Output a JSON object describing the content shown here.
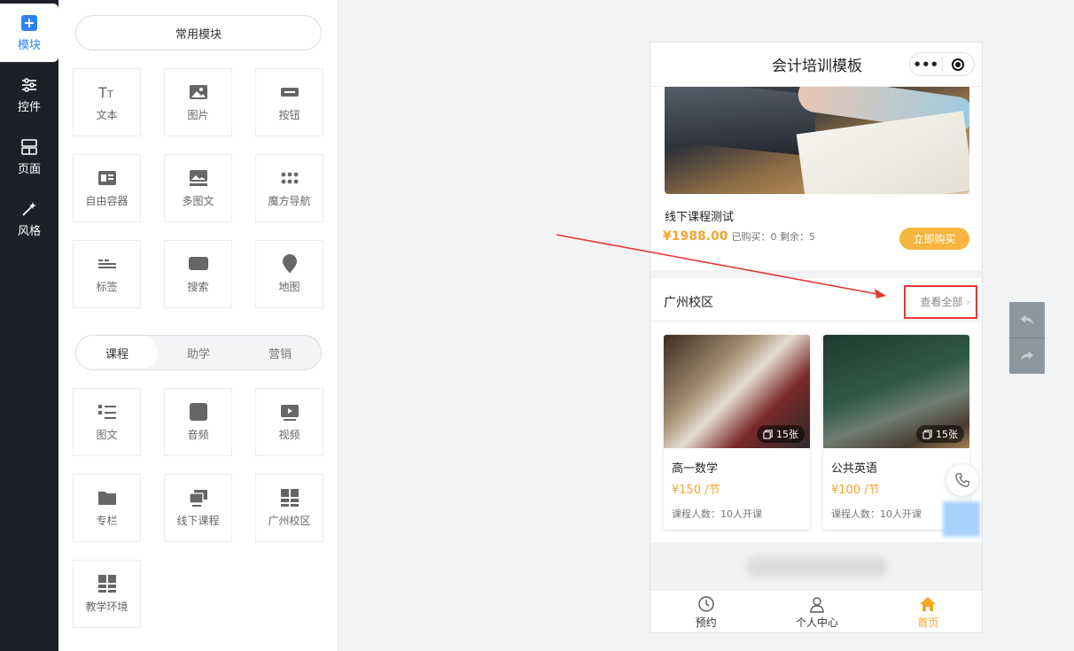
{
  "rail": {
    "items": [
      {
        "label": "模块",
        "icon": "plus-square-icon"
      },
      {
        "label": "控件",
        "icon": "sliders-icon"
      },
      {
        "label": "页面",
        "icon": "layout-icon"
      },
      {
        "label": "风格",
        "icon": "magic-wand-icon"
      }
    ]
  },
  "panel": {
    "common_label": "常用模块",
    "common_modules": [
      {
        "label": "文本",
        "icon": "text-icon"
      },
      {
        "label": "图片",
        "icon": "image-icon"
      },
      {
        "label": "按钮",
        "icon": "button-icon"
      },
      {
        "label": "自由容器",
        "icon": "container-icon"
      },
      {
        "label": "多图文",
        "icon": "multi-image-icon"
      },
      {
        "label": "魔方导航",
        "icon": "dots-grid-icon"
      },
      {
        "label": "标签",
        "icon": "tag-icon"
      },
      {
        "label": "搜索",
        "icon": "search-icon"
      },
      {
        "label": "地图",
        "icon": "map-pin-icon"
      }
    ],
    "tabs": [
      "课程",
      "助学",
      "营销"
    ],
    "course_modules": [
      {
        "label": "图文",
        "icon": "list-icon"
      },
      {
        "label": "音频",
        "icon": "music-icon"
      },
      {
        "label": "视频",
        "icon": "video-icon"
      },
      {
        "label": "专栏",
        "icon": "folder-icon"
      },
      {
        "label": "线下课程",
        "icon": "offline-course-icon"
      },
      {
        "label": "广州校区",
        "icon": "campus-grid-icon"
      },
      {
        "label": "教学环境",
        "icon": "environment-grid-icon"
      }
    ]
  },
  "phone": {
    "title": "会计培训模板",
    "capsule_more": "•••",
    "course": {
      "title": "线下课程测试",
      "price": "¥1988.00",
      "meta": "已购买：0 剩余：5",
      "buy_label": "立即购买"
    },
    "campus": {
      "title": "广州校区",
      "view_all": "查看全部",
      "cards": [
        {
          "name": "高一数学",
          "price": "¥150 /节",
          "people": "课程人数：10人开课",
          "badge": "15张"
        },
        {
          "name": "公共英语",
          "price": "¥100 /节",
          "people": "课程人数：10人开课",
          "badge": "15张"
        }
      ]
    },
    "tabbar": [
      {
        "label": "预约",
        "icon": "clock-icon"
      },
      {
        "label": "个人中心",
        "icon": "user-icon"
      },
      {
        "label": "首页",
        "icon": "home-icon"
      }
    ]
  },
  "colors": {
    "accent": "#f5b53f",
    "price": "#f3a530",
    "highlight": "#e53935",
    "rail_bg": "#1d2026",
    "active_blue": "#2d82f5"
  }
}
